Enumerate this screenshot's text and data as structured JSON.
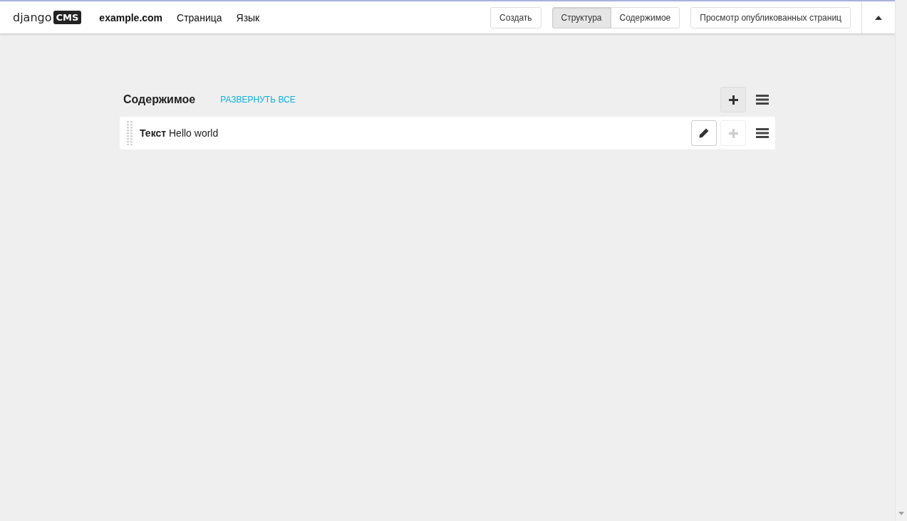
{
  "toolbar": {
    "logo": {
      "wordmark": "django",
      "badge": "CMS"
    },
    "site": "example.com",
    "menu": [
      "Страница",
      "Язык"
    ],
    "create_button": "Создать",
    "modes": [
      {
        "label": "Структура",
        "selected": true
      },
      {
        "label": "Содержимое",
        "selected": false
      }
    ],
    "view_published_button": "Просмотр опубликованных страниц"
  },
  "placeholder": {
    "title": "Содержимое",
    "expand_link": "РАЗВЕРНУТЬ ВСЕ",
    "plugins": [
      {
        "text": "**Текст** Hello world",
        "add_disabled": true
      }
    ]
  }
}
